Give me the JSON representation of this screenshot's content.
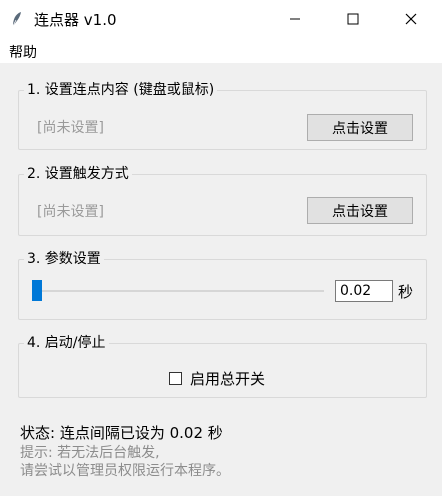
{
  "window": {
    "title": "连点器 v1.0",
    "icons": {
      "app": "feather-icon",
      "minimize": "minimize-icon",
      "maximize": "maximize-icon",
      "close": "close-icon"
    }
  },
  "menu": {
    "help": "帮助"
  },
  "section1": {
    "title": "1. 设置连点内容 (键盘或鼠标)",
    "value": "[尚未设置]",
    "button": "点击设置"
  },
  "section2": {
    "title": "2. 设置触发方式",
    "value": "[尚未设置]",
    "button": "点击设置"
  },
  "section3": {
    "title": "3. 参数设置",
    "interval_value": "0.02",
    "unit": "秒",
    "slider_level": 0
  },
  "section4": {
    "title": "4. 启动/停止",
    "toggle_label": "启用总开关",
    "toggle_checked": false
  },
  "status": {
    "text": "状态: 连点间隔已设为 0.02 秒",
    "hint_line1": "提示: 若无法后台触发,",
    "hint_line2": "请尝试以管理员权限运行本程序。"
  },
  "colors": {
    "accent": "#0078d7",
    "placeholder": "#9a9a9a"
  }
}
